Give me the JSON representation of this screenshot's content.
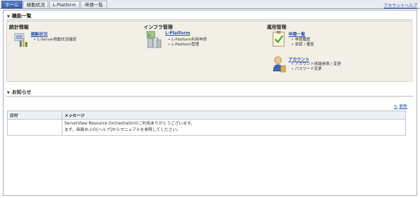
{
  "nav": {
    "tabs": [
      "ホーム",
      "稼動状況",
      "L-Platform",
      "申請一覧"
    ],
    "account": "アカウント",
    "help": "ヘルプ"
  },
  "functions": {
    "title": "機能一覧",
    "stats": {
      "title": "統計情報",
      "link": "稼動状況",
      "bullets": [
        "L-Server稼動状況確認"
      ]
    },
    "infra": {
      "title": "インフラ管理",
      "link": "L-Platform",
      "bullets": [
        "L-Platform利用申請",
        "L-Platform管理"
      ]
    },
    "ops": {
      "title": "運用管理",
      "link": "申請一覧",
      "bullets": [
        "申請履歴",
        "承認 / 審査"
      ],
      "account_link": "アカウント",
      "account_bullets": [
        "アカウント情報参照 / 変更",
        "パスワード変更"
      ]
    }
  },
  "news": {
    "title": "お知らせ",
    "refresh": "更新",
    "columns": [
      "日付",
      "メッセージ"
    ],
    "rows": [
      {
        "date": "",
        "message1": "ServerView Resource Orchestratorのご利用ありがとうございます。",
        "message2": "まず、画面右上の[ヘルプ]からマニュアルを参照してください。"
      }
    ]
  },
  "colors": {
    "active_tab": "#2f5aa8",
    "link": "#2c4db0",
    "panel_bg": "#f2f0e6"
  }
}
